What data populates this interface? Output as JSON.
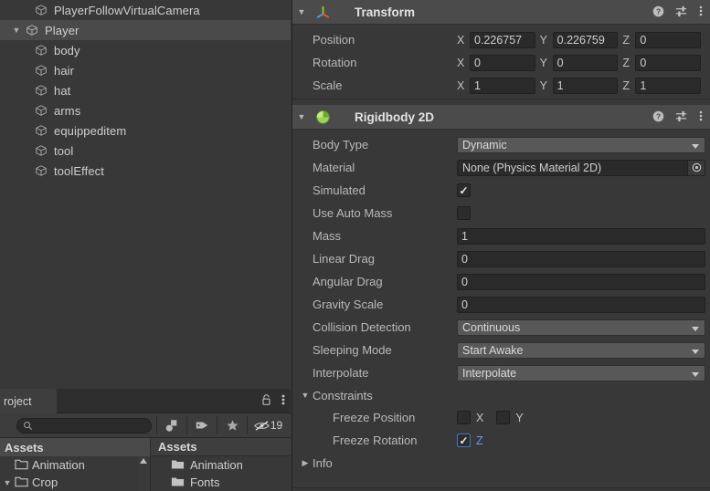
{
  "hierarchy": {
    "rows": [
      {
        "label": "PlayerFollowVirtualCamera",
        "indent": 1,
        "twirl": "",
        "selected": false
      },
      {
        "label": "Player",
        "indent": 0,
        "twirl": "▼",
        "selected": true
      },
      {
        "label": "body",
        "indent": 2,
        "twirl": "",
        "selected": false
      },
      {
        "label": "hair",
        "indent": 2,
        "twirl": "",
        "selected": false
      },
      {
        "label": "hat",
        "indent": 2,
        "twirl": "",
        "selected": false
      },
      {
        "label": "arms",
        "indent": 2,
        "twirl": "",
        "selected": false
      },
      {
        "label": "equippeditem",
        "indent": 2,
        "twirl": "",
        "selected": false
      },
      {
        "label": "tool",
        "indent": 2,
        "twirl": "",
        "selected": false
      },
      {
        "label": "toolEffect",
        "indent": 2,
        "twirl": "",
        "selected": false
      }
    ]
  },
  "project": {
    "tab_label": "roject",
    "search_placeholder": "",
    "search_value": "",
    "hidden_count": "19",
    "tree": {
      "header": "Assets",
      "rows": [
        {
          "label": "Animation",
          "twirl": "",
          "indent": 0
        },
        {
          "label": "Crop",
          "twirl": "▼",
          "indent": 0
        }
      ]
    },
    "content": {
      "header": "Assets",
      "rows": [
        {
          "label": "Animation"
        },
        {
          "label": "Fonts"
        }
      ]
    }
  },
  "inspector": {
    "transform": {
      "title": "Transform",
      "twirl": "▼",
      "rows": [
        {
          "label": "Position",
          "x_axis": "X",
          "x": "0.226757",
          "y_axis": "Y",
          "y": "0.226759",
          "z_axis": "Z",
          "z": "0"
        },
        {
          "label": "Rotation",
          "x_axis": "X",
          "x": "0",
          "y_axis": "Y",
          "y": "0",
          "z_axis": "Z",
          "z": "0"
        },
        {
          "label": "Scale",
          "x_axis": "X",
          "x": "1",
          "y_axis": "Y",
          "y": "1",
          "z_axis": "Z",
          "z": "1"
        }
      ]
    },
    "rigidbody2d": {
      "title": "Rigidbody 2D",
      "twirl": "▼",
      "body_type": {
        "label": "Body Type",
        "value": "Dynamic"
      },
      "material": {
        "label": "Material",
        "value": "None (Physics Material 2D)"
      },
      "simulated": {
        "label": "Simulated",
        "checked": true
      },
      "use_auto_mass": {
        "label": "Use Auto Mass",
        "checked": false
      },
      "mass": {
        "label": "Mass",
        "value": "1"
      },
      "linear_drag": {
        "label": "Linear Drag",
        "value": "0"
      },
      "angular_drag": {
        "label": "Angular Drag",
        "value": "0"
      },
      "gravity_scale": {
        "label": "Gravity Scale",
        "value": "0"
      },
      "collision_detection": {
        "label": "Collision Detection",
        "value": "Continuous"
      },
      "sleeping_mode": {
        "label": "Sleeping Mode",
        "value": "Start Awake"
      },
      "interpolate": {
        "label": "Interpolate",
        "value": "Interpolate"
      },
      "constraints": {
        "label": "Constraints",
        "twirl": "▼",
        "freeze_position": {
          "label": "Freeze Position",
          "x_axis": "X",
          "x_checked": false,
          "y_axis": "Y",
          "y_checked": false
        },
        "freeze_rotation": {
          "label": "Freeze Rotation",
          "z_axis": "Z",
          "z_checked": true
        }
      },
      "info": {
        "label": "Info",
        "twirl": "▶"
      }
    }
  }
}
